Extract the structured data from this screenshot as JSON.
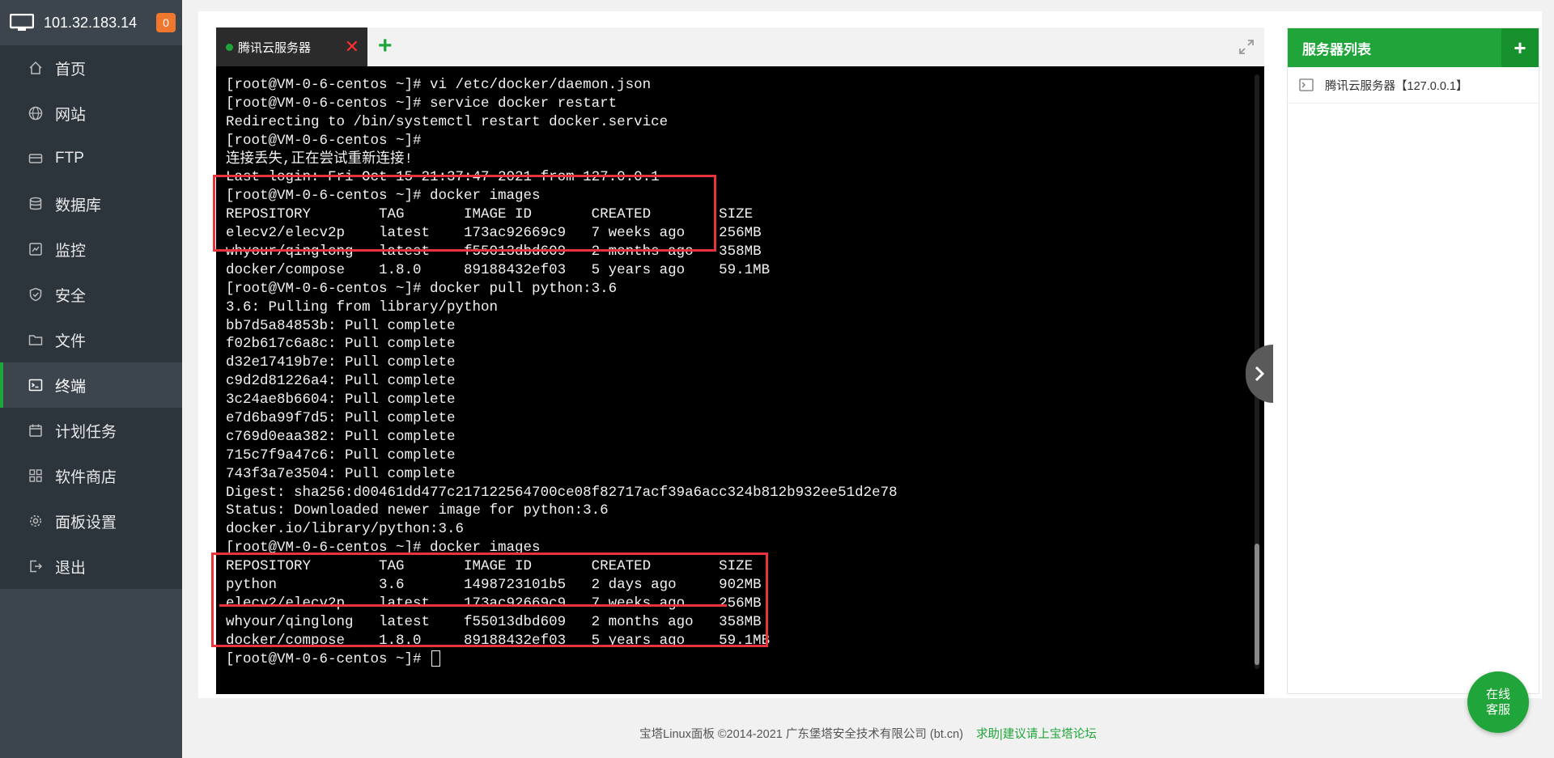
{
  "sidebar": {
    "ip": "101.32.183.14",
    "badge": "0",
    "items": [
      {
        "label": "首页",
        "icon": "home-icon"
      },
      {
        "label": "网站",
        "icon": "globe-icon"
      },
      {
        "label": "FTP",
        "icon": "ftp-icon"
      },
      {
        "label": "数据库",
        "icon": "database-icon"
      },
      {
        "label": "监控",
        "icon": "monitor-chart-icon"
      },
      {
        "label": "安全",
        "icon": "shield-icon"
      },
      {
        "label": "文件",
        "icon": "folder-icon"
      },
      {
        "label": "终端",
        "icon": "terminal-icon",
        "active": true
      },
      {
        "label": "计划任务",
        "icon": "calendar-icon"
      },
      {
        "label": "软件商店",
        "icon": "grid-icon"
      },
      {
        "label": "面板设置",
        "icon": "gear-icon"
      },
      {
        "label": "退出",
        "icon": "logout-icon"
      }
    ]
  },
  "terminal": {
    "tab_label": "腾讯云服务器",
    "lines": [
      "[root@VM-0-6-centos ~]# vi /etc/docker/daemon.json",
      "[root@VM-0-6-centos ~]# service docker restart",
      "Redirecting to /bin/systemctl restart docker.service",
      "[root@VM-0-6-centos ~]#",
      "连接丢失,正在尝试重新连接!",
      "Last login: Fri Oct 15 21:37:47 2021 from 127.0.0.1",
      "[root@VM-0-6-centos ~]# docker images",
      "REPOSITORY        TAG       IMAGE ID       CREATED        SIZE",
      "elecv2/elecv2p    latest    173ac92669c9   7 weeks ago    256MB",
      "whyour/qinglong   latest    f55013dbd609   2 months ago   358MB",
      "docker/compose    1.8.0     89188432ef03   5 years ago    59.1MB",
      "[root@VM-0-6-centos ~]# docker pull python:3.6",
      "3.6: Pulling from library/python",
      "bb7d5a84853b: Pull complete",
      "f02b617c6a8c: Pull complete",
      "d32e17419b7e: Pull complete",
      "c9d2d81226a4: Pull complete",
      "3c24ae8b6604: Pull complete",
      "e7d6ba99f7d5: Pull complete",
      "c769d0eaa382: Pull complete",
      "715c7f9a47c6: Pull complete",
      "743f3a7e3504: Pull complete",
      "Digest: sha256:d00461dd477c217122564700ce08f82717acf39a6acc324b812b932ee51d2e78",
      "Status: Downloaded newer image for python:3.6",
      "docker.io/library/python:3.6",
      "[root@VM-0-6-centos ~]# docker images",
      "REPOSITORY        TAG       IMAGE ID       CREATED        SIZE",
      "python            3.6       1498723101b5   2 days ago     902MB",
      "elecv2/elecv2p    latest    173ac92669c9   7 weeks ago    256MB",
      "whyour/qinglong   latest    f55013dbd609   2 months ago   358MB",
      "docker/compose    1.8.0     89188432ef03   5 years ago    59.1MB",
      "[root@VM-0-6-centos ~]# "
    ]
  },
  "server_list": {
    "title": "服务器列表",
    "items": [
      {
        "label": "腾讯云服务器【127.0.0.1】"
      }
    ]
  },
  "footer": {
    "copyright": "宝塔Linux面板 ©2014-2021 广东堡塔安全技术有限公司 (bt.cn)",
    "link": "求助|建议请上宝塔论坛"
  },
  "chat": {
    "line1": "在线",
    "line2": "客服"
  },
  "colors": {
    "accent": "#20a53a",
    "sidebar_bg": "#3c444d",
    "highlight_red": "#e8333a"
  }
}
